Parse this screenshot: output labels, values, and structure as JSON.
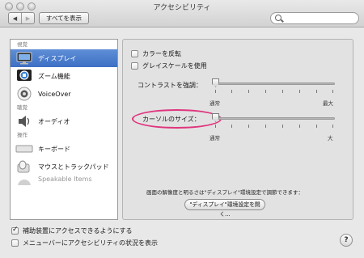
{
  "window": {
    "title": "アクセシビリティ"
  },
  "toolbar": {
    "back_label": "◀",
    "forward_label": "▶",
    "show_all_label": "すべてを表示",
    "search_placeholder": ""
  },
  "sidebar": {
    "headers": {
      "vision": "視覚",
      "hearing": "聴覚",
      "interaction": "操作"
    },
    "items": {
      "display": "ディスプレイ",
      "zoom": "ズーム機能",
      "voiceover": "VoiceOver",
      "audio": "オーディオ",
      "keyboard": "キーボード",
      "mouse": "マウスとトラックパッド",
      "speakable": "Speakable Items"
    },
    "selected": "display"
  },
  "panel": {
    "invert_colors": {
      "label": "カラーを反転",
      "checked": false
    },
    "grayscale": {
      "label": "グレイスケールを使用",
      "checked": false
    },
    "contrast": {
      "label": "コントラストを強調：",
      "min": "通常",
      "max": "最大",
      "value": 0
    },
    "cursor": {
      "label": "カーソルのサイズ：",
      "min": "通常",
      "max": "大",
      "value": 0
    },
    "note": "画面の解像度と明るさは\"ディスプレイ\"環境設定で調節できます：",
    "open_display_button": "\"ディスプレイ\"環境設定を開く..."
  },
  "bottom": {
    "enable_access": {
      "label": "補助装置にアクセスできるようにする",
      "checked": true
    },
    "menubar_status": {
      "label": "メニューバーにアクセシビリティの状況を表示",
      "checked": false
    },
    "help_label": "?"
  },
  "colors": {
    "selection": "#3d6fc4",
    "highlight_ring": "#e0357e"
  }
}
